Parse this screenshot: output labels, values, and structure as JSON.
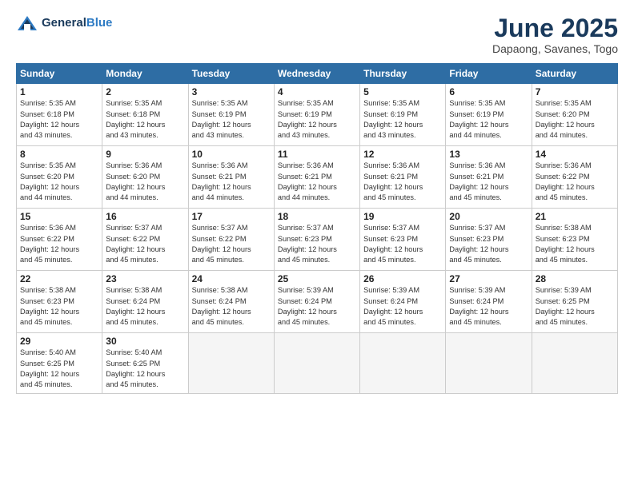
{
  "header": {
    "logo_general": "General",
    "logo_blue": "Blue",
    "title": "June 2025",
    "subtitle": "Dapaong, Savanes, Togo"
  },
  "columns": [
    "Sunday",
    "Monday",
    "Tuesday",
    "Wednesday",
    "Thursday",
    "Friday",
    "Saturday"
  ],
  "weeks": [
    [
      {
        "day": "1",
        "sunrise": "5:35 AM",
        "sunset": "6:18 PM",
        "daylight": "12 hours and 43 minutes."
      },
      {
        "day": "2",
        "sunrise": "5:35 AM",
        "sunset": "6:18 PM",
        "daylight": "12 hours and 43 minutes."
      },
      {
        "day": "3",
        "sunrise": "5:35 AM",
        "sunset": "6:19 PM",
        "daylight": "12 hours and 43 minutes."
      },
      {
        "day": "4",
        "sunrise": "5:35 AM",
        "sunset": "6:19 PM",
        "daylight": "12 hours and 43 minutes."
      },
      {
        "day": "5",
        "sunrise": "5:35 AM",
        "sunset": "6:19 PM",
        "daylight": "12 hours and 43 minutes."
      },
      {
        "day": "6",
        "sunrise": "5:35 AM",
        "sunset": "6:19 PM",
        "daylight": "12 hours and 44 minutes."
      },
      {
        "day": "7",
        "sunrise": "5:35 AM",
        "sunset": "6:20 PM",
        "daylight": "12 hours and 44 minutes."
      }
    ],
    [
      {
        "day": "8",
        "sunrise": "5:35 AM",
        "sunset": "6:20 PM",
        "daylight": "12 hours and 44 minutes."
      },
      {
        "day": "9",
        "sunrise": "5:36 AM",
        "sunset": "6:20 PM",
        "daylight": "12 hours and 44 minutes."
      },
      {
        "day": "10",
        "sunrise": "5:36 AM",
        "sunset": "6:21 PM",
        "daylight": "12 hours and 44 minutes."
      },
      {
        "day": "11",
        "sunrise": "5:36 AM",
        "sunset": "6:21 PM",
        "daylight": "12 hours and 44 minutes."
      },
      {
        "day": "12",
        "sunrise": "5:36 AM",
        "sunset": "6:21 PM",
        "daylight": "12 hours and 45 minutes."
      },
      {
        "day": "13",
        "sunrise": "5:36 AM",
        "sunset": "6:21 PM",
        "daylight": "12 hours and 45 minutes."
      },
      {
        "day": "14",
        "sunrise": "5:36 AM",
        "sunset": "6:22 PM",
        "daylight": "12 hours and 45 minutes."
      }
    ],
    [
      {
        "day": "15",
        "sunrise": "5:36 AM",
        "sunset": "6:22 PM",
        "daylight": "12 hours and 45 minutes."
      },
      {
        "day": "16",
        "sunrise": "5:37 AM",
        "sunset": "6:22 PM",
        "daylight": "12 hours and 45 minutes."
      },
      {
        "day": "17",
        "sunrise": "5:37 AM",
        "sunset": "6:22 PM",
        "daylight": "12 hours and 45 minutes."
      },
      {
        "day": "18",
        "sunrise": "5:37 AM",
        "sunset": "6:23 PM",
        "daylight": "12 hours and 45 minutes."
      },
      {
        "day": "19",
        "sunrise": "5:37 AM",
        "sunset": "6:23 PM",
        "daylight": "12 hours and 45 minutes."
      },
      {
        "day": "20",
        "sunrise": "5:37 AM",
        "sunset": "6:23 PM",
        "daylight": "12 hours and 45 minutes."
      },
      {
        "day": "21",
        "sunrise": "5:38 AM",
        "sunset": "6:23 PM",
        "daylight": "12 hours and 45 minutes."
      }
    ],
    [
      {
        "day": "22",
        "sunrise": "5:38 AM",
        "sunset": "6:23 PM",
        "daylight": "12 hours and 45 minutes."
      },
      {
        "day": "23",
        "sunrise": "5:38 AM",
        "sunset": "6:24 PM",
        "daylight": "12 hours and 45 minutes."
      },
      {
        "day": "24",
        "sunrise": "5:38 AM",
        "sunset": "6:24 PM",
        "daylight": "12 hours and 45 minutes."
      },
      {
        "day": "25",
        "sunrise": "5:39 AM",
        "sunset": "6:24 PM",
        "daylight": "12 hours and 45 minutes."
      },
      {
        "day": "26",
        "sunrise": "5:39 AM",
        "sunset": "6:24 PM",
        "daylight": "12 hours and 45 minutes."
      },
      {
        "day": "27",
        "sunrise": "5:39 AM",
        "sunset": "6:24 PM",
        "daylight": "12 hours and 45 minutes."
      },
      {
        "day": "28",
        "sunrise": "5:39 AM",
        "sunset": "6:25 PM",
        "daylight": "12 hours and 45 minutes."
      }
    ],
    [
      {
        "day": "29",
        "sunrise": "5:40 AM",
        "sunset": "6:25 PM",
        "daylight": "12 hours and 45 minutes."
      },
      {
        "day": "30",
        "sunrise": "5:40 AM",
        "sunset": "6:25 PM",
        "daylight": "12 hours and 45 minutes."
      },
      null,
      null,
      null,
      null,
      null
    ]
  ],
  "labels": {
    "sunrise": "Sunrise:",
    "sunset": "Sunset:",
    "daylight": "Daylight:"
  }
}
